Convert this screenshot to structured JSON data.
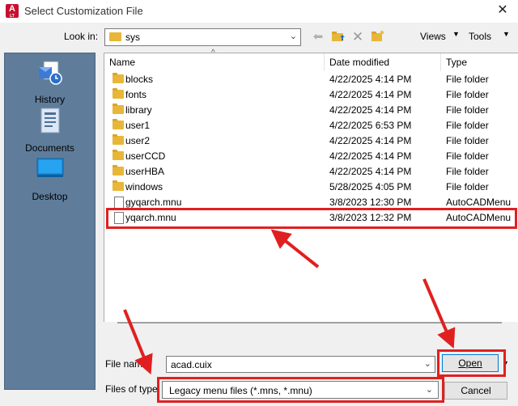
{
  "window": {
    "title": "Select Customization File",
    "app_icon_letter": "A",
    "app_icon_sub": "LT"
  },
  "toolbar": {
    "look_in_label": "Look in:",
    "look_in_value": "sys",
    "views_label": "Views",
    "tools_label": "Tools"
  },
  "places": [
    {
      "label": "History",
      "icon": "history-icon"
    },
    {
      "label": "Documents",
      "icon": "documents-icon"
    },
    {
      "label": "Desktop",
      "icon": "desktop-icon"
    }
  ],
  "columns": {
    "name": "Name",
    "date": "Date modified",
    "type": "Type"
  },
  "files": [
    {
      "name": "blocks",
      "date": "4/22/2025 4:14 PM",
      "type": "File folder",
      "icon": "folder-icon"
    },
    {
      "name": "fonts",
      "date": "4/22/2025 4:14 PM",
      "type": "File folder",
      "icon": "folder-icon"
    },
    {
      "name": "library",
      "date": "4/22/2025 4:14 PM",
      "type": "File folder",
      "icon": "folder-icon"
    },
    {
      "name": "user1",
      "date": "4/22/2025 6:53 PM",
      "type": "File folder",
      "icon": "folder-icon"
    },
    {
      "name": "user2",
      "date": "4/22/2025 4:14 PM",
      "type": "File folder",
      "icon": "folder-icon"
    },
    {
      "name": "userCCD",
      "date": "4/22/2025 4:14 PM",
      "type": "File folder",
      "icon": "folder-icon"
    },
    {
      "name": "userHBA",
      "date": "4/22/2025 4:14 PM",
      "type": "File folder",
      "icon": "folder-icon"
    },
    {
      "name": "windows",
      "date": "5/28/2025 4:05 PM",
      "type": "File folder",
      "icon": "folder-icon"
    },
    {
      "name": "gyqarch.mnu",
      "date": "3/8/2023 12:30 PM",
      "type": "AutoCADMenu",
      "icon": "file-icon"
    },
    {
      "name": "yqarch.mnu",
      "date": "3/8/2023 12:32 PM",
      "type": "AutoCADMenu",
      "icon": "file-icon"
    }
  ],
  "bottom": {
    "file_name_label": "File name:",
    "file_name_value": "acad.cuix",
    "files_of_type_label": "Files of type:",
    "files_of_type_value": "Legacy menu files (*.mns, *.mnu)",
    "open_label": "Open",
    "cancel_label": "Cancel"
  },
  "colors": {
    "annotation": "#e02020",
    "places_bar": "#5f7d9b",
    "folder": "#e8b73a"
  }
}
